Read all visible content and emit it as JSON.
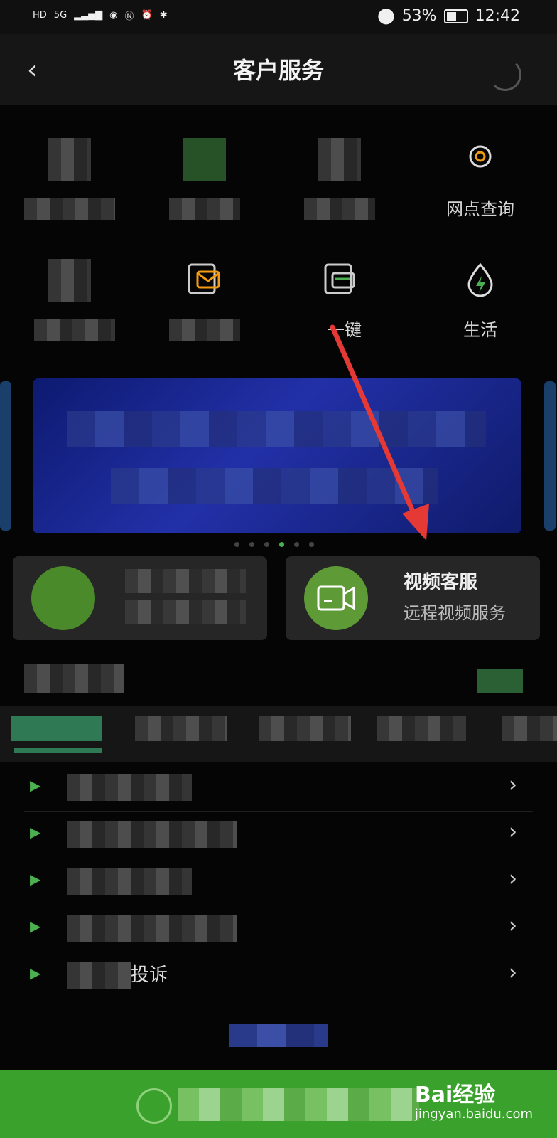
{
  "status_bar": {
    "left_badges": [
      "HD",
      "5G"
    ],
    "battery_percent": "53%",
    "battery_level": 0.53,
    "time": "12:42",
    "icons": [
      "signal-icon",
      "eye-icon",
      "nfc-icon",
      "alarm-icon",
      "bluetooth-icon",
      "location-icon",
      "battery-icon"
    ]
  },
  "header": {
    "title": "客户服务",
    "back_icon": "chevron-left-icon",
    "right_icon": "headset-icon"
  },
  "grid": {
    "row1": [
      {
        "label": "",
        "icon": "bill-icon"
      },
      {
        "label": "",
        "icon": "app-icon"
      },
      {
        "label": "",
        "icon": "app-icon"
      },
      {
        "label": "网点查询",
        "icon": "location-pin-icon"
      }
    ],
    "row2": [
      {
        "label": "",
        "icon": "gauge-icon"
      },
      {
        "label": "",
        "icon": "mail-icon"
      },
      {
        "label": "一键",
        "icon": "card-icon"
      },
      {
        "label": "生活",
        "icon": "drop-bolt-icon"
      }
    ]
  },
  "carousel": {
    "active_index": 3,
    "total": 6
  },
  "cards": {
    "left": {
      "title": "",
      "subtitle": "",
      "icon": "app-icon"
    },
    "right": {
      "title": "视频客服",
      "subtitle": "远程视频服务",
      "icon": "video-camera-icon"
    }
  },
  "section": {
    "title": "",
    "tabs": [
      "",
      "",
      "",
      "",
      ""
    ]
  },
  "list": [
    {
      "text": "",
      "icon": "play-icon"
    },
    {
      "text": "",
      "icon": "play-icon"
    },
    {
      "text": "",
      "icon": "play-icon"
    },
    {
      "text": "",
      "icon": "play-icon"
    },
    {
      "text": "投诉",
      "icon": "play-icon"
    }
  ],
  "bottom_bar": {
    "text": "",
    "watermark_brand": "Bai经验",
    "watermark_url": "jingyan.baidu.com"
  },
  "colors": {
    "accent_green": "#4caf50",
    "bottom_green": "#3aa12c",
    "annotation_red": "#e53935"
  }
}
